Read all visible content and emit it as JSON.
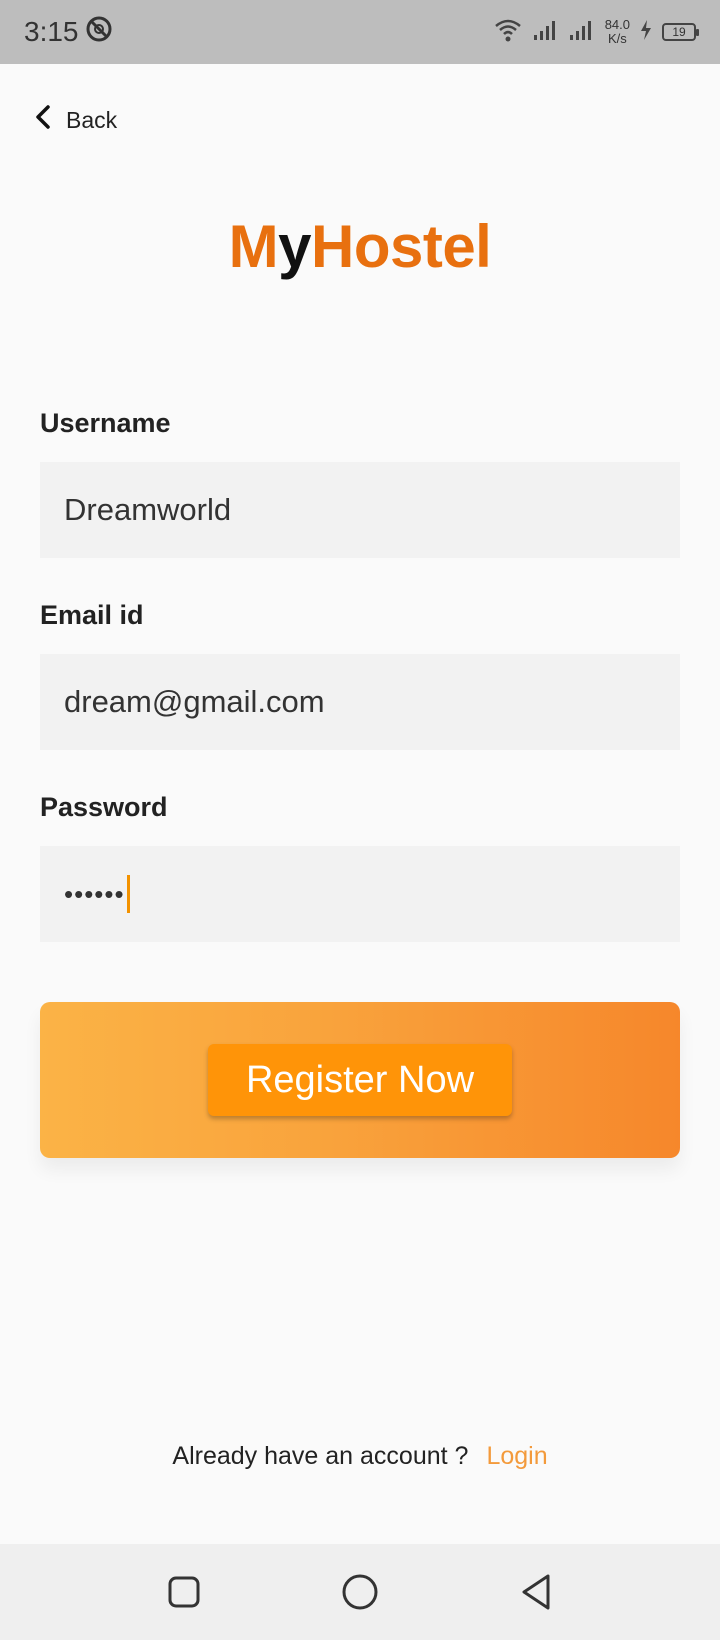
{
  "status_bar": {
    "time": "3:15",
    "speed_value": "84.0",
    "speed_unit": "K/s",
    "battery": "19"
  },
  "header": {
    "back_label": "Back"
  },
  "logo": {
    "part1": "M",
    "part2": "y",
    "part3": "Hostel"
  },
  "form": {
    "username_label": "Username",
    "username_value": "Dreamworld",
    "email_label": "Email id",
    "email_value": "dream@gmail.com",
    "password_label": "Password",
    "password_mask": "••••••"
  },
  "actions": {
    "register_label": "Register Now",
    "prompt_text": "Already have an account ?",
    "login_link": "Login"
  },
  "colors": {
    "brand_orange": "#e8700f",
    "button_orange": "#ff9408",
    "link_orange": "#f39a3b"
  }
}
